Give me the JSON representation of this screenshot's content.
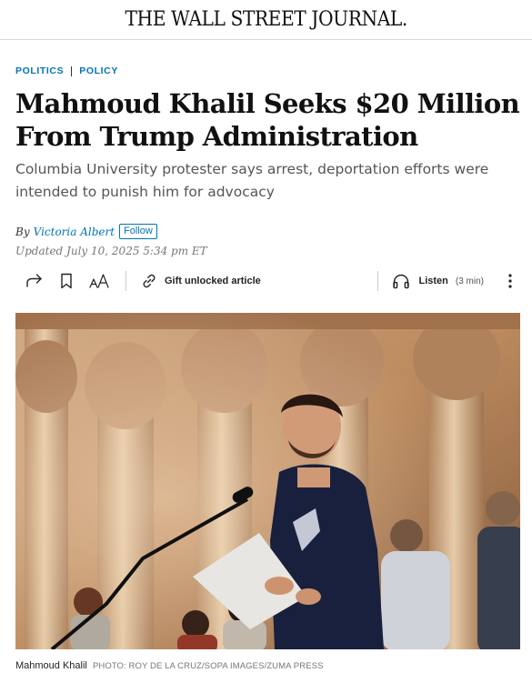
{
  "masthead": {
    "logo": "THE WALL STREET JOURNAL."
  },
  "breadcrumb": {
    "items": [
      {
        "label": "POLITICS"
      },
      {
        "label": "POLICY"
      }
    ]
  },
  "article": {
    "headline": "Mahmoud Khalil Seeks $20 Million From Trump Administration",
    "dek": "Columbia University protester says arrest, deportation efforts were intended to punish him for advocacy",
    "byline": {
      "prefix": "By",
      "author": "Victoria Albert",
      "follow_label": "Follow"
    },
    "updated": "Updated July 10, 2025 5:34 pm ET"
  },
  "toolbar": {
    "icons": {
      "share": "share-icon",
      "bookmark": "bookmark-icon",
      "text_size": "text-size-icon",
      "gift": "gift-link-icon",
      "listen": "headphones-icon",
      "more": "more-vertical-icon"
    },
    "gift_label": "Gift unlocked article",
    "listen_label": "Listen",
    "listen_duration": "(3 min)"
  },
  "photo": {
    "caption": "Mahmoud Khalil",
    "credit": "PHOTO: ROY DE LA CRUZ/SOPA IMAGES/ZUMA PRESS"
  },
  "colors": {
    "link": "#0274b6",
    "text": "#111111",
    "dek": "#555555"
  }
}
